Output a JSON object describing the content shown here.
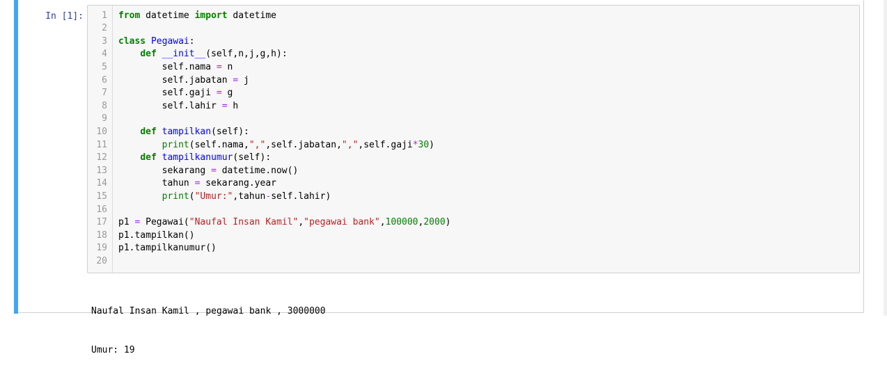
{
  "cell": {
    "prompt": "In [1]:",
    "code_lines": [
      [
        {
          "t": "kw",
          "v": "from"
        },
        {
          "t": "",
          "v": " datetime "
        },
        {
          "t": "kw",
          "v": "import"
        },
        {
          "t": "",
          "v": " datetime"
        }
      ],
      [],
      [
        {
          "t": "kw",
          "v": "class"
        },
        {
          "t": "",
          "v": " "
        },
        {
          "t": "def",
          "v": "Pegawai"
        },
        {
          "t": "",
          "v": ":"
        }
      ],
      [
        {
          "t": "",
          "v": "    "
        },
        {
          "t": "kw",
          "v": "def"
        },
        {
          "t": "",
          "v": " "
        },
        {
          "t": "def",
          "v": "__init__"
        },
        {
          "t": "",
          "v": "(self,n,j,g,h):"
        }
      ],
      [
        {
          "t": "",
          "v": "        self.nama "
        },
        {
          "t": "op",
          "v": "="
        },
        {
          "t": "",
          "v": " n"
        }
      ],
      [
        {
          "t": "",
          "v": "        self.jabatan "
        },
        {
          "t": "op",
          "v": "="
        },
        {
          "t": "",
          "v": " j"
        }
      ],
      [
        {
          "t": "",
          "v": "        self.gaji "
        },
        {
          "t": "op",
          "v": "="
        },
        {
          "t": "",
          "v": " g"
        }
      ],
      [
        {
          "t": "",
          "v": "        self.lahir "
        },
        {
          "t": "op",
          "v": "="
        },
        {
          "t": "",
          "v": " h"
        }
      ],
      [],
      [
        {
          "t": "",
          "v": "    "
        },
        {
          "t": "kw",
          "v": "def"
        },
        {
          "t": "",
          "v": " "
        },
        {
          "t": "def",
          "v": "tampilkan"
        },
        {
          "t": "",
          "v": "(self):"
        }
      ],
      [
        {
          "t": "",
          "v": "        "
        },
        {
          "t": "num",
          "v": "print"
        },
        {
          "t": "",
          "v": "(self.nama,"
        },
        {
          "t": "str",
          "v": "\",\""
        },
        {
          "t": "",
          "v": ",self.jabatan,"
        },
        {
          "t": "str",
          "v": "\",\""
        },
        {
          "t": "",
          "v": ",self.gaji"
        },
        {
          "t": "op",
          "v": "*"
        },
        {
          "t": "num",
          "v": "30"
        },
        {
          "t": "",
          "v": ")"
        }
      ],
      [
        {
          "t": "",
          "v": "    "
        },
        {
          "t": "kw",
          "v": "def"
        },
        {
          "t": "",
          "v": " "
        },
        {
          "t": "def",
          "v": "tampilkanumur"
        },
        {
          "t": "",
          "v": "(self):"
        }
      ],
      [
        {
          "t": "",
          "v": "        sekarang "
        },
        {
          "t": "op",
          "v": "="
        },
        {
          "t": "",
          "v": " datetime.now()"
        }
      ],
      [
        {
          "t": "",
          "v": "        tahun "
        },
        {
          "t": "op",
          "v": "="
        },
        {
          "t": "",
          "v": " sekarang.year"
        }
      ],
      [
        {
          "t": "",
          "v": "        "
        },
        {
          "t": "num",
          "v": "print"
        },
        {
          "t": "",
          "v": "("
        },
        {
          "t": "str",
          "v": "\"Umur:\""
        },
        {
          "t": "",
          "v": ",tahun"
        },
        {
          "t": "op",
          "v": "-"
        },
        {
          "t": "",
          "v": "self.lahir)"
        }
      ],
      [],
      [
        {
          "t": "",
          "v": "p1 "
        },
        {
          "t": "op",
          "v": "="
        },
        {
          "t": "",
          "v": " Pegawai("
        },
        {
          "t": "str",
          "v": "\"Naufal Insan Kamil\""
        },
        {
          "t": "",
          "v": ","
        },
        {
          "t": "str",
          "v": "\"pegawai bank\""
        },
        {
          "t": "",
          "v": ","
        },
        {
          "t": "num",
          "v": "100000"
        },
        {
          "t": "",
          "v": ","
        },
        {
          "t": "num",
          "v": "2000"
        },
        {
          "t": "",
          "v": ")"
        }
      ],
      [
        {
          "t": "",
          "v": "p1.tampilkan()"
        }
      ],
      [
        {
          "t": "",
          "v": "p1.tampilkanumur()"
        }
      ],
      []
    ],
    "output_lines": [
      "Naufal Insan Kamil , pegawai bank , 3000000",
      "Umur: 19"
    ]
  }
}
